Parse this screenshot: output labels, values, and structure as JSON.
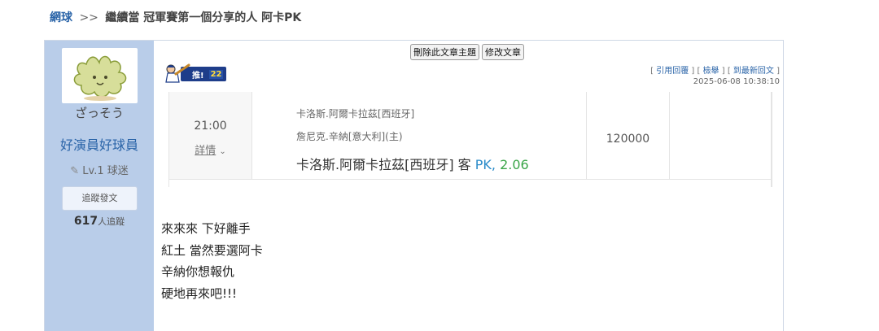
{
  "breadcrumb": {
    "category": "網球",
    "separator": ">>",
    "title": "繼續當 冠軍賽第一個分享的人 阿卡PK"
  },
  "author": {
    "avatar_name": "ざっそう",
    "name": "好演員好球員",
    "level": "Lv.1 球迷",
    "follow_label": "追蹤發文",
    "followers_count": "617",
    "followers_suffix": "人追蹤"
  },
  "admin": {
    "delete_label": "刪除此文章主題",
    "edit_label": "修改文章"
  },
  "push": {
    "label": "推!",
    "count": "22"
  },
  "post_links": {
    "quote": "引用回覆",
    "report": "檢舉",
    "latest": "到最新回文"
  },
  "post_date": "2025-06-08 10:38:10",
  "match": {
    "time": "21:00",
    "detail_label": "詳情",
    "team_away": "卡洛斯.阿爾卡拉茲[西班牙]",
    "team_home": "詹尼克.辛納[意大利](主)",
    "pick_team": "卡洛斯.阿爾卡拉茲[西班牙] 客",
    "pick_type": "PK,",
    "pick_odds": "2.06",
    "amount": "120000"
  },
  "content_lines": [
    "來來來 下好離手",
    "紅土 當然要選阿卡",
    "辛納你想報仇",
    "硬地再來吧!!!"
  ],
  "colors": {
    "link_blue": "#2a64a8",
    "sidebar_bg": "#b9cde9",
    "pk_blue": "#2a8bc9",
    "odds_green": "#3aa548"
  }
}
